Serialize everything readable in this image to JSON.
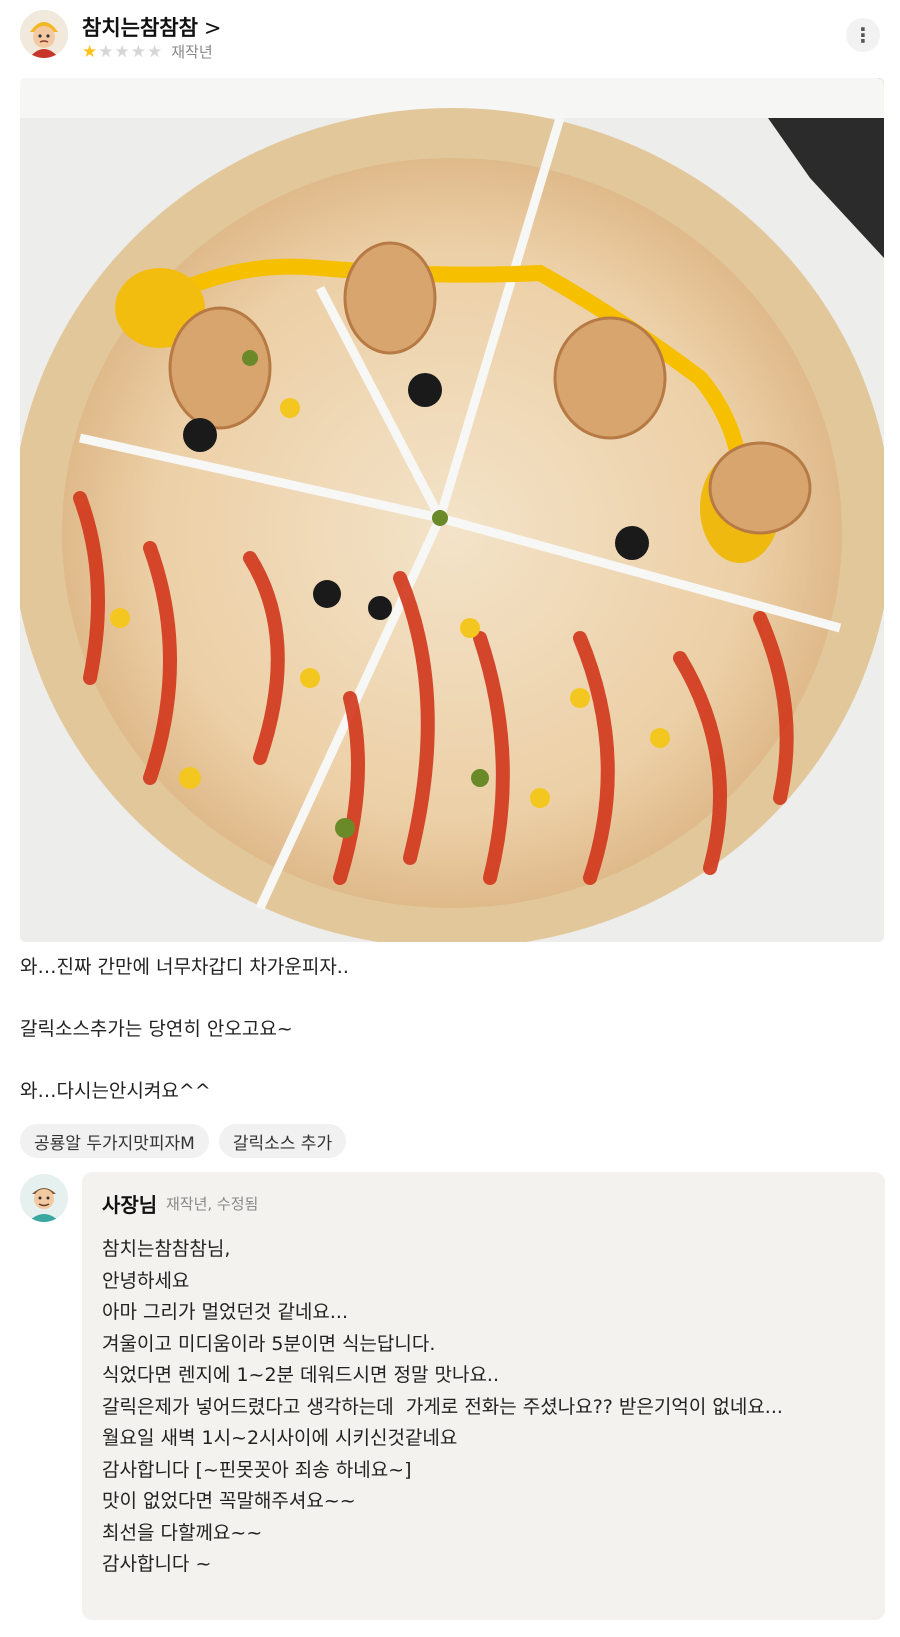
{
  "review": {
    "username": "참치는참참참",
    "chevron": ">",
    "rating": 1,
    "rating_max": 5,
    "date": "재작년",
    "more": "⋮",
    "lines": [
      "와…진짜 간만에 너무차갑디 차가운피자..",
      "갈릭소스추가는 당연히 안오고요~",
      "와…다시는안시켜요^^"
    ],
    "tags": [
      "공룡알 두가지맛피자M",
      "갈릭소스 추가"
    ]
  },
  "reply": {
    "name": "사장님",
    "meta": "재작년, 수정됨",
    "lines": [
      "참치는참참참님,",
      "안녕하세요",
      "아마 그리가 멀었던것 같네요...",
      "겨울이고 미디움이라 5분이면 식는답니다.",
      "식었다면 렌지에 1~2분 데워드시면 정말 맛나요..",
      "갈릭은제가 넣어드렸다고 생각하는데  가게로 전화는 주셨나요?? 받은기억이 없네요...",
      "월요일 새벽 1시~2시사이에 시키신것같네요",
      "감사합니다 [~핀못꼿아 죄송 하네요~]",
      "맛이 없었다면 꼭말해주셔요~~",
      "최선을 다할께요~~",
      "감사합니다 ~"
    ]
  },
  "colors": {
    "star_on": "#ffc21a",
    "star_off": "#d6d6d6",
    "reply_bg": "#f3f2ef",
    "tag_bg": "#f1f1f1"
  }
}
